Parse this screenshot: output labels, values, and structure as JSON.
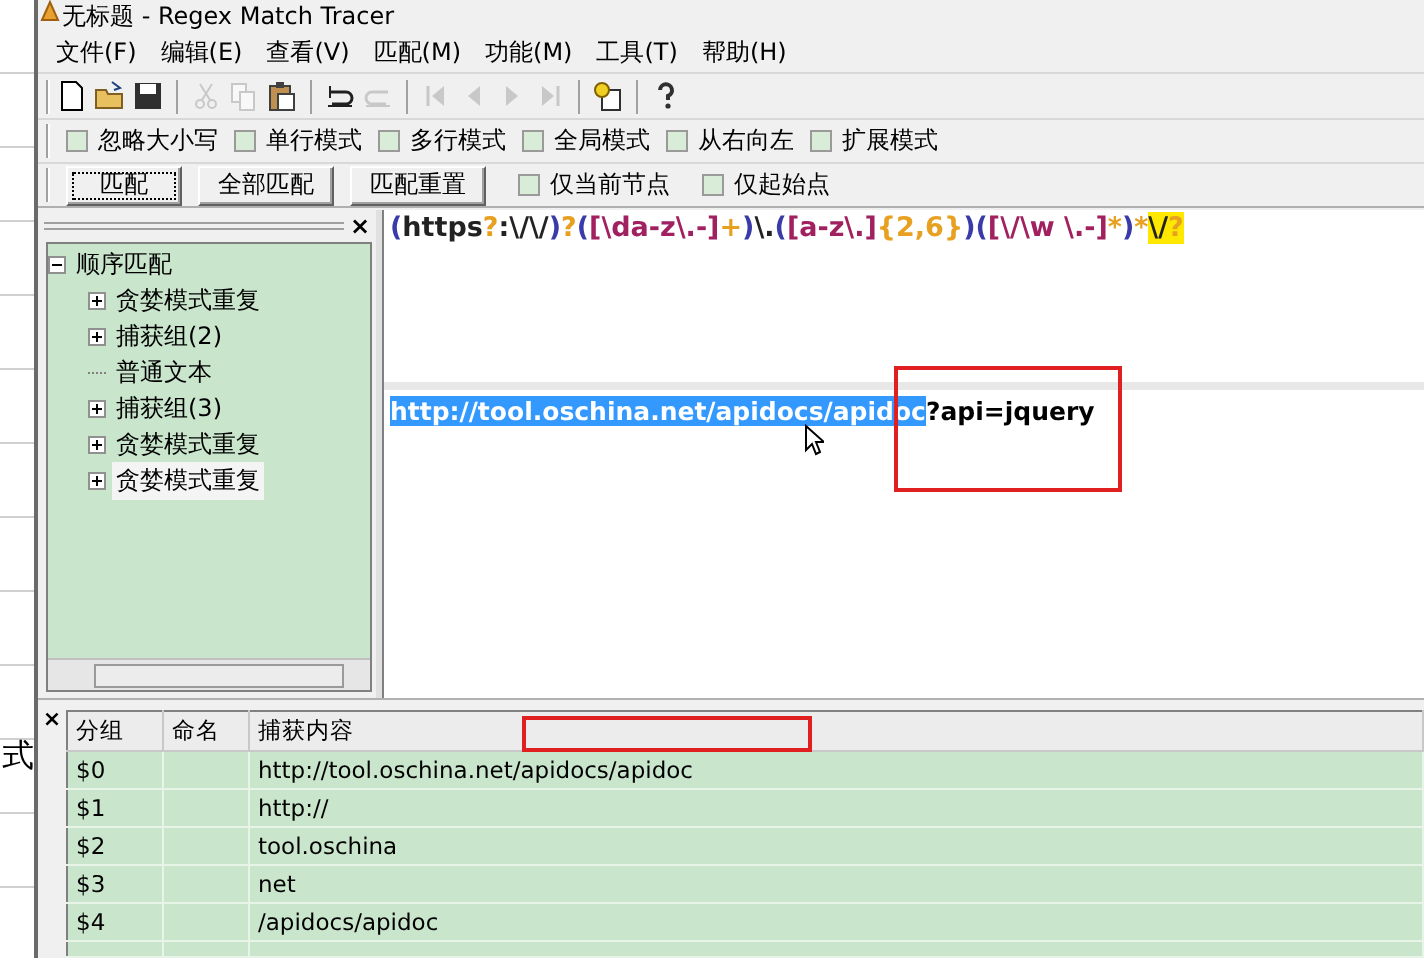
{
  "background_window": {
    "text": "式"
  },
  "window": {
    "title": "无标题 - Regex Match Tracer"
  },
  "menu": [
    "文件(F)",
    "编辑(E)",
    "查看(V)",
    "匹配(M)",
    "功能(M)",
    "工具(T)",
    "帮助(H)"
  ],
  "toolbar": [
    {
      "kind": "new",
      "disabled": false
    },
    {
      "kind": "open",
      "disabled": false
    },
    {
      "kind": "save",
      "disabled": false
    },
    {
      "kind": "sep"
    },
    {
      "kind": "cut",
      "disabled": true
    },
    {
      "kind": "copy",
      "disabled": true
    },
    {
      "kind": "paste",
      "disabled": false
    },
    {
      "kind": "sep"
    },
    {
      "kind": "undo",
      "disabled": false
    },
    {
      "kind": "redo",
      "disabled": true
    },
    {
      "kind": "sep"
    },
    {
      "kind": "first",
      "disabled": true
    },
    {
      "kind": "prev",
      "disabled": true
    },
    {
      "kind": "next",
      "disabled": true
    },
    {
      "kind": "last",
      "disabled": true
    },
    {
      "kind": "sep"
    },
    {
      "kind": "add",
      "disabled": false
    },
    {
      "kind": "sep"
    },
    {
      "kind": "help",
      "disabled": false
    }
  ],
  "options": [
    {
      "label": "忽略大小写",
      "checked": false
    },
    {
      "label": "单行模式",
      "checked": false
    },
    {
      "label": "多行模式",
      "checked": false
    },
    {
      "label": "全局模式",
      "checked": false
    },
    {
      "label": "从右向左",
      "checked": false
    },
    {
      "label": "扩展模式",
      "checked": false
    }
  ],
  "actions": [
    {
      "kind": "button",
      "label": "匹配",
      "focused": true
    },
    {
      "kind": "button",
      "label": "全部匹配",
      "focused": false
    },
    {
      "kind": "button",
      "label": "匹配重置",
      "focused": false
    },
    {
      "kind": "checkbox",
      "label": "仅当前节点",
      "checked": false
    },
    {
      "kind": "checkbox",
      "label": "仅起始点",
      "checked": false
    }
  ],
  "tree_panel": {
    "close": "×"
  },
  "tree": [
    {
      "label": "顺序匹配",
      "expanded": true,
      "selected": false,
      "children": [
        {
          "label": "贪婪模式重复",
          "expanded": false,
          "selected": false
        },
        {
          "label": "捕获组(2)",
          "expanded": false,
          "selected": false
        },
        {
          "label": "普通文本",
          "selected": false
        },
        {
          "label": "捕获组(3)",
          "expanded": false,
          "selected": false
        },
        {
          "label": "贪婪模式重复",
          "expanded": false,
          "selected": false
        },
        {
          "label": "贪婪模式重复",
          "expanded": false,
          "selected": true
        }
      ]
    }
  ],
  "regex": [
    {
      "text": "(",
      "kind": "group",
      "highlighted": false
    },
    {
      "text": "https",
      "kind": "literal",
      "highlighted": false
    },
    {
      "text": "?",
      "kind": "quantifier",
      "highlighted": false
    },
    {
      "text": ":\\/\\/",
      "kind": "literal",
      "highlighted": false
    },
    {
      "text": ")",
      "kind": "group",
      "highlighted": false
    },
    {
      "text": "?",
      "kind": "quantifier",
      "highlighted": false
    },
    {
      "text": "(",
      "kind": "group",
      "highlighted": false
    },
    {
      "text": "[\\da-z\\.-]",
      "kind": "class",
      "highlighted": false
    },
    {
      "text": "+",
      "kind": "quantifier",
      "highlighted": false
    },
    {
      "text": ")",
      "kind": "group",
      "highlighted": false
    },
    {
      "text": "\\.",
      "kind": "literal",
      "highlighted": false
    },
    {
      "text": "(",
      "kind": "group",
      "highlighted": false
    },
    {
      "text": "[a-z\\.]",
      "kind": "class",
      "highlighted": false
    },
    {
      "text": "{2,6}",
      "kind": "quantifier",
      "highlighted": false
    },
    {
      "text": ")",
      "kind": "group",
      "highlighted": false
    },
    {
      "text": "(",
      "kind": "group",
      "highlighted": false
    },
    {
      "text": "[\\/\\w \\.-]",
      "kind": "class",
      "highlighted": false
    },
    {
      "text": "*",
      "kind": "quantifier",
      "highlighted": false
    },
    {
      "text": ")",
      "kind": "group",
      "highlighted": false
    },
    {
      "text": "*",
      "kind": "quantifier",
      "highlighted": false
    },
    {
      "text": "\\/",
      "kind": "literal",
      "highlighted": true
    },
    {
      "text": "?",
      "kind": "quantifier",
      "highlighted": true
    }
  ],
  "test_text": [
    {
      "text": "http://tool.oschina.net/apidocs/apidoc",
      "selected": true
    },
    {
      "text": "?api=jquery",
      "selected": false
    }
  ],
  "results": {
    "close": "×",
    "columns": [
      "分组",
      "命名",
      "捕获内容"
    ],
    "rows": [
      {
        "group": "$0",
        "content": "http://tool.oschina.net/apidocs/apidoc"
      },
      {
        "group": "$1",
        "content": "http://"
      },
      {
        "group": "$2",
        "content": "tool.oschina"
      },
      {
        "group": "$3",
        "content": "net"
      },
      {
        "group": "$4",
        "content": "/apidocs/apidoc"
      }
    ]
  }
}
